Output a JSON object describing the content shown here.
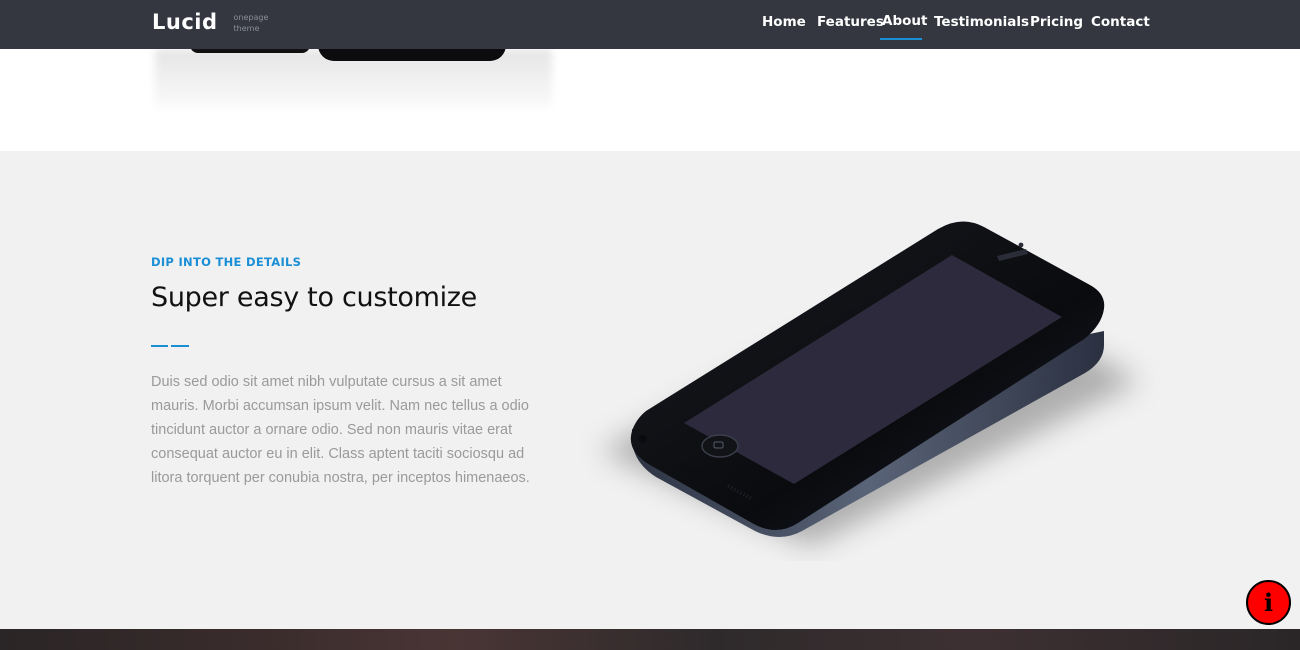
{
  "nav": {
    "brand": "Lucid",
    "brand_tagline": [
      "onepage",
      "theme"
    ],
    "links": [
      {
        "label": "Home",
        "active": false
      },
      {
        "label": "Features",
        "active": false
      },
      {
        "label": "About",
        "active": true
      },
      {
        "label": "Testimonials",
        "active": false
      },
      {
        "label": "Pricing",
        "active": false
      },
      {
        "label": "Contact",
        "active": false
      }
    ]
  },
  "feature": {
    "eyebrow": "DIP INTO THE DETAILS",
    "headline": "Super easy to customize",
    "body": "Duis sed odio sit amet nibh vulputate cursus a sit amet mauris. Morbi accumsan ipsum velit. Nam nec tellus a odio tincidunt auctor a ornare odio. Sed non mauris vitae erat consequat auctor eu in elit. Class aptent taciti sociosqu ad litora torquent per conubia nostra, per inceptos himenaeos.",
    "image_icon": "smartphone-icon"
  },
  "info_button": {
    "icon": "info-icon",
    "glyph": "i"
  },
  "colors": {
    "navbar_bg": "#343740",
    "accent": "#1b8fd6",
    "section_bg": "#f1f1f1",
    "body_text": "#9a9a9a",
    "info_button_bg": "#ff0000"
  }
}
